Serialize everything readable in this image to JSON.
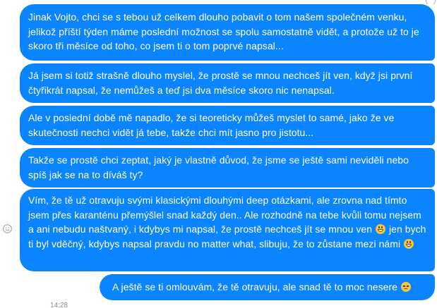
{
  "messages": [
    {
      "text": "Jinak Vojto, chci se s tebou už celkem dlouho pobavit o tom našem společném venku, jelikož příští týden máme poslední možnost se spolu samostatně vidět, a protože už to je skoro tři měsíce od toho, co jsem ti o tom poprvé napsal..."
    },
    {
      "text": "Já jsem si totiž strašně dlouho myslel, že prostě se mnou nechceš jít ven, když jsi první čtyřikrát napsal, že nemůžeš a teď jsi dva měsíce skoro nic nenapsal."
    },
    {
      "text": "Ale v poslední době mě napadlo, že si teoreticky můžeš myslet to samé, jako že ve skutečnosti nechci vidět já tebe, takže chci mít jasno pro jistotu..."
    },
    {
      "text": "Takže se prostě chci zeptat, jaký je vlastně důvod, že jsme se ještě sami neviděli nebo spíš jak se na to díváš ty?"
    },
    {
      "text_part1": "Vím, že tě už otravuju svými klasickými dlouhými deep otázkami, ale zrovna nad tímto jsem přes karanténu přemýšlel snad každý den.. Ale rozhodně na tebe kvůli tomu nejsem a ani nebudu naštvaný, i kdybys mi napsal, že prostě nechceš jít se mnou ven",
      "emoji1": "grinning-face-emoji",
      "text_part2": " jen bych ti byl vděčný, kdybys napsal pravdu no matter what, slibuju, že to zůstane mezi námi",
      "emoji2": "grinning-face-emoji"
    },
    {
      "text": "A ještě se ti omlouvám, že tě otravuju, ale snad tě to moc nesere",
      "emoji": "disappointed-face-emoji"
    }
  ],
  "timestamp": "14:28",
  "colors": {
    "bubble": "#0a84ff",
    "text": "#ffffff",
    "background": "#ffffff"
  },
  "icons": {
    "react": "smiley-react-icon",
    "top": "seen-indicator-icon"
  }
}
